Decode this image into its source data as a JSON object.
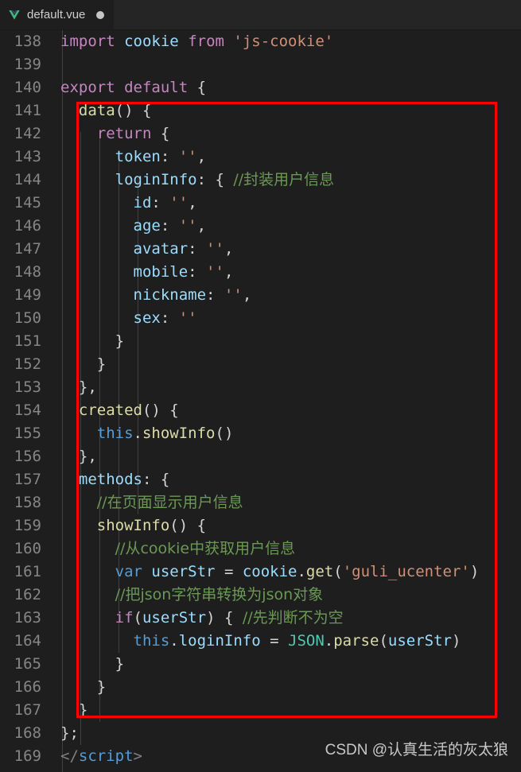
{
  "tab": {
    "icon": "vue-logo-icon",
    "filename": "default.vue",
    "dirty_indicator": "unsaved-dot"
  },
  "editor": {
    "theme_background": "#1e1e1e",
    "gutter_color": "#858585",
    "first_line_number": 138,
    "lines": [
      {
        "n": "138",
        "tokens": [
          {
            "t": "import",
            "c": "kw"
          },
          {
            "t": " ",
            "c": "pun"
          },
          {
            "t": "cookie",
            "c": "var"
          },
          {
            "t": " ",
            "c": "pun"
          },
          {
            "t": "from",
            "c": "kw"
          },
          {
            "t": " ",
            "c": "pun"
          },
          {
            "t": "'js-cookie'",
            "c": "str"
          }
        ]
      },
      {
        "n": "139",
        "tokens": []
      },
      {
        "n": "140",
        "tokens": [
          {
            "t": "export",
            "c": "kw"
          },
          {
            "t": " ",
            "c": "pun"
          },
          {
            "t": "default",
            "c": "kw"
          },
          {
            "t": " {",
            "c": "pun"
          }
        ]
      },
      {
        "n": "141",
        "tokens": [
          {
            "t": "  ",
            "c": "pun"
          },
          {
            "t": "data",
            "c": "fn"
          },
          {
            "t": "() {",
            "c": "pun"
          }
        ]
      },
      {
        "n": "142",
        "tokens": [
          {
            "t": "    ",
            "c": "pun"
          },
          {
            "t": "return",
            "c": "kw"
          },
          {
            "t": " {",
            "c": "pun"
          }
        ]
      },
      {
        "n": "143",
        "tokens": [
          {
            "t": "      ",
            "c": "pun"
          },
          {
            "t": "token",
            "c": "var"
          },
          {
            "t": ": ",
            "c": "pun"
          },
          {
            "t": "''",
            "c": "str"
          },
          {
            "t": ",",
            "c": "pun"
          }
        ]
      },
      {
        "n": "144",
        "tokens": [
          {
            "t": "      ",
            "c": "pun"
          },
          {
            "t": "loginInfo",
            "c": "var"
          },
          {
            "t": ": { ",
            "c": "pun"
          },
          {
            "t": "//封装用户信息",
            "c": "cmt"
          }
        ]
      },
      {
        "n": "145",
        "tokens": [
          {
            "t": "        ",
            "c": "pun"
          },
          {
            "t": "id",
            "c": "var"
          },
          {
            "t": ": ",
            "c": "pun"
          },
          {
            "t": "''",
            "c": "str"
          },
          {
            "t": ",",
            "c": "pun"
          }
        ]
      },
      {
        "n": "146",
        "tokens": [
          {
            "t": "        ",
            "c": "pun"
          },
          {
            "t": "age",
            "c": "var"
          },
          {
            "t": ": ",
            "c": "pun"
          },
          {
            "t": "''",
            "c": "str"
          },
          {
            "t": ",",
            "c": "pun"
          }
        ]
      },
      {
        "n": "147",
        "tokens": [
          {
            "t": "        ",
            "c": "pun"
          },
          {
            "t": "avatar",
            "c": "var"
          },
          {
            "t": ": ",
            "c": "pun"
          },
          {
            "t": "''",
            "c": "str"
          },
          {
            "t": ",",
            "c": "pun"
          }
        ]
      },
      {
        "n": "148",
        "tokens": [
          {
            "t": "        ",
            "c": "pun"
          },
          {
            "t": "mobile",
            "c": "var"
          },
          {
            "t": ": ",
            "c": "pun"
          },
          {
            "t": "''",
            "c": "str"
          },
          {
            "t": ",",
            "c": "pun"
          }
        ]
      },
      {
        "n": "149",
        "tokens": [
          {
            "t": "        ",
            "c": "pun"
          },
          {
            "t": "nickname",
            "c": "var"
          },
          {
            "t": ": ",
            "c": "pun"
          },
          {
            "t": "''",
            "c": "str"
          },
          {
            "t": ",",
            "c": "pun"
          }
        ]
      },
      {
        "n": "150",
        "tokens": [
          {
            "t": "        ",
            "c": "pun"
          },
          {
            "t": "sex",
            "c": "var"
          },
          {
            "t": ": ",
            "c": "pun"
          },
          {
            "t": "''",
            "c": "str"
          }
        ]
      },
      {
        "n": "151",
        "tokens": [
          {
            "t": "      }",
            "c": "pun"
          }
        ]
      },
      {
        "n": "152",
        "tokens": [
          {
            "t": "    }",
            "c": "pun"
          }
        ]
      },
      {
        "n": "153",
        "tokens": [
          {
            "t": "  },",
            "c": "pun"
          }
        ]
      },
      {
        "n": "154",
        "tokens": [
          {
            "t": "  ",
            "c": "pun"
          },
          {
            "t": "created",
            "c": "fn"
          },
          {
            "t": "() {",
            "c": "pun"
          }
        ]
      },
      {
        "n": "155",
        "tokens": [
          {
            "t": "    ",
            "c": "pun"
          },
          {
            "t": "this",
            "c": "blue"
          },
          {
            "t": ".",
            "c": "pun"
          },
          {
            "t": "showInfo",
            "c": "fn"
          },
          {
            "t": "()",
            "c": "pun"
          }
        ]
      },
      {
        "n": "156",
        "tokens": [
          {
            "t": "  },",
            "c": "pun"
          }
        ]
      },
      {
        "n": "157",
        "tokens": [
          {
            "t": "  ",
            "c": "pun"
          },
          {
            "t": "methods",
            "c": "var"
          },
          {
            "t": ": {",
            "c": "pun"
          }
        ]
      },
      {
        "n": "158",
        "tokens": [
          {
            "t": "    ",
            "c": "pun"
          },
          {
            "t": "//在页面显示用户信息",
            "c": "cmt"
          }
        ]
      },
      {
        "n": "159",
        "tokens": [
          {
            "t": "    ",
            "c": "pun"
          },
          {
            "t": "showInfo",
            "c": "fn"
          },
          {
            "t": "() {",
            "c": "pun"
          }
        ]
      },
      {
        "n": "160",
        "tokens": [
          {
            "t": "      ",
            "c": "pun"
          },
          {
            "t": "//从cookie中获取用户信息",
            "c": "cmt"
          }
        ]
      },
      {
        "n": "161",
        "tokens": [
          {
            "t": "      ",
            "c": "pun"
          },
          {
            "t": "var",
            "c": "blue"
          },
          {
            "t": " ",
            "c": "pun"
          },
          {
            "t": "userStr",
            "c": "var"
          },
          {
            "t": " = ",
            "c": "pun"
          },
          {
            "t": "cookie",
            "c": "var"
          },
          {
            "t": ".",
            "c": "pun"
          },
          {
            "t": "get",
            "c": "fn"
          },
          {
            "t": "(",
            "c": "pun"
          },
          {
            "t": "'guli_ucenter'",
            "c": "str"
          },
          {
            "t": ")",
            "c": "pun"
          }
        ]
      },
      {
        "n": "162",
        "tokens": [
          {
            "t": "      ",
            "c": "pun"
          },
          {
            "t": "//把json字符串转换为json对象",
            "c": "cmt"
          }
        ]
      },
      {
        "n": "163",
        "tokens": [
          {
            "t": "      ",
            "c": "pun"
          },
          {
            "t": "if",
            "c": "kw"
          },
          {
            "t": "(",
            "c": "pun"
          },
          {
            "t": "userStr",
            "c": "var"
          },
          {
            "t": ") { ",
            "c": "pun"
          },
          {
            "t": "//先判断不为空",
            "c": "cmt"
          }
        ]
      },
      {
        "n": "164",
        "tokens": [
          {
            "t": "        ",
            "c": "pun"
          },
          {
            "t": "this",
            "c": "blue"
          },
          {
            "t": ".",
            "c": "pun"
          },
          {
            "t": "loginInfo",
            "c": "var"
          },
          {
            "t": " = ",
            "c": "pun"
          },
          {
            "t": "JSON",
            "c": "cls"
          },
          {
            "t": ".",
            "c": "pun"
          },
          {
            "t": "parse",
            "c": "fn"
          },
          {
            "t": "(",
            "c": "pun"
          },
          {
            "t": "userStr",
            "c": "var"
          },
          {
            "t": ")",
            "c": "pun"
          }
        ]
      },
      {
        "n": "165",
        "tokens": [
          {
            "t": "      }",
            "c": "pun"
          }
        ]
      },
      {
        "n": "166",
        "tokens": [
          {
            "t": "    }",
            "c": "pun"
          }
        ]
      },
      {
        "n": "167",
        "tokens": [
          {
            "t": "  }",
            "c": "pun"
          }
        ]
      },
      {
        "n": "168",
        "tokens": [
          {
            "t": "};",
            "c": "pun"
          }
        ]
      },
      {
        "n": "169",
        "tokens": [
          {
            "t": "<",
            "c": "brk"
          },
          {
            "t": "/",
            "c": "brk"
          },
          {
            "t": "script",
            "c": "blue"
          },
          {
            "t": ">",
            "c": "brk"
          }
        ]
      }
    ]
  },
  "annotation": {
    "type": "red-rectangle-highlight",
    "color": "#ff0000",
    "covers_lines": "141-167"
  },
  "watermark": {
    "text": "CSDN @认真生活的灰太狼"
  }
}
